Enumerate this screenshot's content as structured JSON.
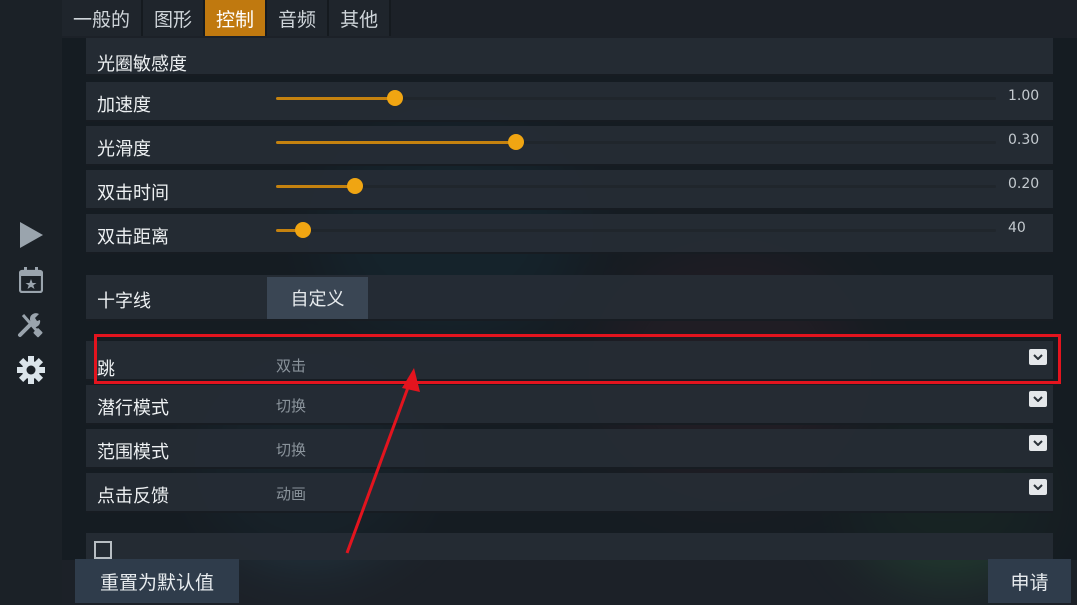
{
  "colors": {
    "accent": "#f0a512",
    "highlight": "#e3141e"
  },
  "sidebar": {
    "icons": [
      "play-icon",
      "calendar-star-icon",
      "tools-icon",
      "gear-icon"
    ]
  },
  "tabs": [
    {
      "label": "一般的",
      "active": false
    },
    {
      "label": "图形",
      "active": false
    },
    {
      "label": "控制",
      "active": true
    },
    {
      "label": "音频",
      "active": false
    },
    {
      "label": "其他",
      "active": false
    }
  ],
  "partial_row_label": "光圈敏感度",
  "sliders": [
    {
      "label": "加速度",
      "value": "1.00",
      "fraction": 0.165
    },
    {
      "label": "光滑度",
      "value": "0.30",
      "fraction": 0.333
    },
    {
      "label": "双击时间",
      "value": "0.20",
      "fraction": 0.11
    },
    {
      "label": "双击距离",
      "value": "40",
      "fraction": 0.038
    }
  ],
  "crosshair": {
    "label": "十字线",
    "button": "自定义"
  },
  "dropdowns": [
    {
      "label": "跳",
      "value": "双击"
    },
    {
      "label": "潜行模式",
      "value": "切换"
    },
    {
      "label": "范围模式",
      "value": "切换"
    },
    {
      "label": "点击反馈",
      "value": "动画"
    }
  ],
  "footer": {
    "reset_label": "重置为默认值",
    "apply_label": "申请"
  }
}
